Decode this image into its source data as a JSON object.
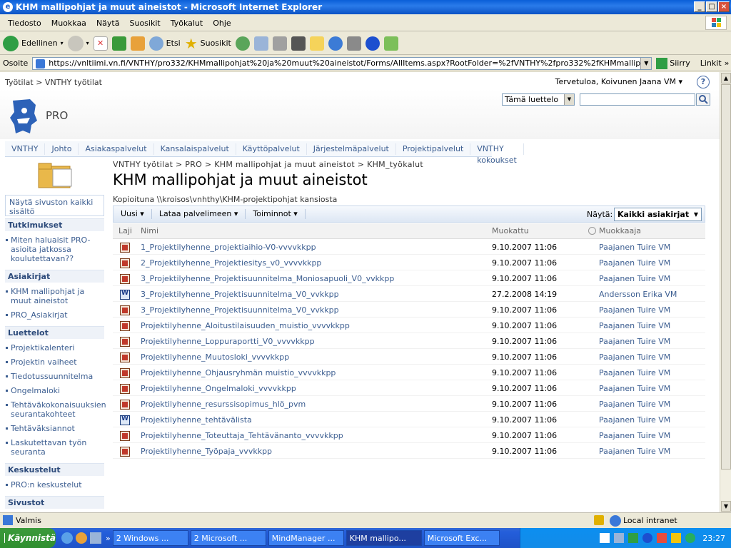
{
  "window": {
    "title": "KHM mallipohjat ja muut aineistot - Microsoft Internet Explorer"
  },
  "menu": [
    "Tiedosto",
    "Muokkaa",
    "Näytä",
    "Suosikit",
    "Työkalut",
    "Ohje"
  ],
  "toolbar": {
    "back": "Edellinen",
    "search": "Etsi",
    "favorites": "Suosikit"
  },
  "address": {
    "label": "Osoite",
    "url": "https://vnltiimi.vn.fi/VNTHY/pro332/KHMmallipohjat%20ja%20muut%20aineistot/Forms/AllItems.aspx?RootFolder=%2fVNTHY%2fpro332%2fKHMmallipohjat%20ja%20muu",
    "go": "Siirry",
    "links": "Linkit"
  },
  "page": {
    "top_breadcrumb": "Työtilat > VNTHY työtilat",
    "welcome": "Tervetuloa, Koivunen Jaana VM",
    "help": "?",
    "site_name": "PRO",
    "search_scope": "Tämä luettelo",
    "topnav": [
      "VNTHY",
      "Johto",
      "Asiakaspalvelut",
      "Kansalaispalvelut",
      "Käyttöpalvelut",
      "Järjestelmäpalvelut",
      "Projektipalvelut",
      "VNTHY kokoukset"
    ],
    "view_all": "Näytä sivuston kaikki sisältö",
    "leftnav": {
      "h1": "Tutkimukset",
      "i1": "Miten haluaisit PRO-asioita jatkossa koulutettavan??",
      "h2": "Asiakirjat",
      "i2": "KHM mallipohjat ja muut aineistot",
      "i3": "PRO_Asiakirjat",
      "h3": "Luettelot",
      "i4": "Projektikalenteri",
      "i5": "Projektin vaiheet",
      "i6": "Tiedotussuunnitelma",
      "i7": "Ongelmaloki",
      "i8": "Tehtäväkokonaisuuksien seurantakohteet",
      "i9": "Tehtäväksiannot",
      "i10": "Laskutettavan työn seuranta",
      "h4": "Keskustelut",
      "i11": "PRO:n keskustelut",
      "h5": "Sivustot"
    },
    "breadcrumb": "VNTHY työtilat > PRO > KHM mallipohjat ja muut aineistot > KHM_työkalut",
    "title": "KHM mallipohjat ja muut aineistot",
    "description": "Kopioituna \\\\kroisos\\vnhthy\\KHM-projektipohjat kansiosta",
    "list_toolbar": {
      "new": "Uusi ▾",
      "upload": "Lataa palvelimeen ▾",
      "actions": "Toiminnot ▾",
      "view_label": "Näytä:",
      "view_value": "Kaikki asiakirjat"
    },
    "columns": {
      "type": "Laji",
      "name": "Nimi",
      "modified": "Muokattu",
      "editor": "Muokkaaja"
    },
    "files": [
      {
        "type": "mpp",
        "name": "1_Projektilyhenne_projektiaihio-V0-vvvvkkpp",
        "modified": "9.10.2007 11:06",
        "editor": "Paajanen Tuire VM"
      },
      {
        "type": "mpp",
        "name": "2_Projektilyhenne_Projektiesitys_v0_vvvvkkpp",
        "modified": "9.10.2007 11:06",
        "editor": "Paajanen Tuire VM"
      },
      {
        "type": "mpp",
        "name": "3_Projektilyhenne_Projektisuunnitelma_Moniosapuoli_V0_vvkkpp",
        "modified": "9.10.2007 11:06",
        "editor": "Paajanen Tuire VM"
      },
      {
        "type": "doc",
        "name": "3_Projektilyhenne_Projektisuunnitelma_V0_vvkkpp",
        "modified": "27.2.2008 14:19",
        "editor": "Andersson Erika VM"
      },
      {
        "type": "mpp",
        "name": "3_Projektilyhenne_Projektisuunnitelma_V0_vvkkpp",
        "modified": "9.10.2007 11:06",
        "editor": "Paajanen Tuire VM"
      },
      {
        "type": "mpp",
        "name": "Projektilyhenne_Aloitustilaisuuden_muistio_vvvvkkpp",
        "modified": "9.10.2007 11:06",
        "editor": "Paajanen Tuire VM"
      },
      {
        "type": "mpp",
        "name": "Projektilyhenne_Loppuraportti_V0_vvvvkkpp",
        "modified": "9.10.2007 11:06",
        "editor": "Paajanen Tuire VM"
      },
      {
        "type": "mpp",
        "name": "Projektilyhenne_Muutosloki_vvvvkkpp",
        "modified": "9.10.2007 11:06",
        "editor": "Paajanen Tuire VM"
      },
      {
        "type": "mpp",
        "name": "Projektilyhenne_Ohjausryhmän muistio_vvvvkkpp",
        "modified": "9.10.2007 11:06",
        "editor": "Paajanen Tuire VM"
      },
      {
        "type": "mpp",
        "name": "Projektilyhenne_Ongelmaloki_vvvvkkpp",
        "modified": "9.10.2007 11:06",
        "editor": "Paajanen Tuire VM"
      },
      {
        "type": "mpp",
        "name": "Projektilyhenne_resurssisopimus_hlö_pvm",
        "modified": "9.10.2007 11:06",
        "editor": "Paajanen Tuire VM"
      },
      {
        "type": "doc",
        "name": "Projektilyhenne_tehtävälista",
        "modified": "9.10.2007 11:06",
        "editor": "Paajanen Tuire VM"
      },
      {
        "type": "mpp",
        "name": "Projektilyhenne_Toteuttaja_Tehtävänanto_vvvvkkpp",
        "modified": "9.10.2007 11:06",
        "editor": "Paajanen Tuire VM"
      },
      {
        "type": "mpp",
        "name": "Projektilyhenne_Työpaja_vvvkkpp",
        "modified": "9.10.2007 11:06",
        "editor": "Paajanen Tuire VM"
      }
    ]
  },
  "status": {
    "text": "Valmis",
    "zone": "Local intranet"
  },
  "taskbar": {
    "start": "Käynnistä",
    "tasks": [
      "2 Windows ...",
      "2 Microsoft ...",
      "MindManager ...",
      "KHM mallipo...",
      "Microsoft Exc..."
    ],
    "clock": "23:27"
  }
}
